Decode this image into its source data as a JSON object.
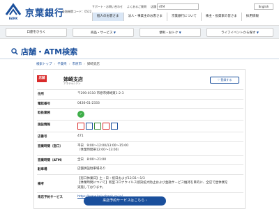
{
  "header": {
    "brand": "京葉銀行",
    "bank_sub": "BANK",
    "bank_code": "金融機関コード：0522",
    "top_links": [
      "サポート・お問い合わせ",
      "よくあるご質問",
      "店舗・ATM"
    ],
    "search_placeholder": "",
    "font_size_label": "",
    "english": "English",
    "segments": [
      "個人のお客さま",
      "法人・事業主のお客さま",
      "京葉銀行について",
      "株主・投資家の皆さま",
      "採用情報"
    ]
  },
  "nav": {
    "items": [
      "口座をひらく",
      "商品・サービス",
      "便利・おトク",
      "ライフイベントから探す"
    ]
  },
  "page": {
    "title": "店舗・ATM検索"
  },
  "breadcrumb": [
    "検索トップ",
    "千葉県",
    "市原市",
    "姉崎支店"
  ],
  "branch": {
    "tag": "店舗",
    "name": "姉崎支店",
    "kana": "アネサキシテン",
    "register_button": "登録する",
    "rows": {
      "address_k": "住所",
      "address_v": "〒299-0110 市原市姉崎東1-2-3",
      "phone_k": "電話番号",
      "phone_v": "0436-61-2333",
      "services_k": "取扱業務",
      "facilities_k": "施設情報",
      "storeno_k": "店番号",
      "storeno_v": "471",
      "hours_k": "営業時間（窓口）",
      "hours_v1": "平日　9:00～12:00/13:00～15:00",
      "hours_v2": "（休業時間帯12:00～13:00）",
      "atm_k": "営業時間（ATM）",
      "atm_v": "全日　8:00～21:00",
      "parking_k": "駐車場",
      "parking_v": "店舗併設駐車場あり",
      "notes_k": "備考",
      "notes_v1": "【窓口休業日】土・日・祝日および12/31～1/3",
      "notes_v2": "【休業時間について】新型コロナウイルス感染拡大防止および金融サービス維持を目的に、全店で昼休業を",
      "notes_v3": "実施しております。",
      "reserve_k": "来店予約サービス",
      "reserve_v": "https://www.keiyobank.co.jp/..."
    },
    "cta": "来店予約サービスはこちら"
  },
  "colors": {
    "brand": "#1a4f9c",
    "tag": "#d92a2a",
    "cta": "#1a4f9c"
  }
}
